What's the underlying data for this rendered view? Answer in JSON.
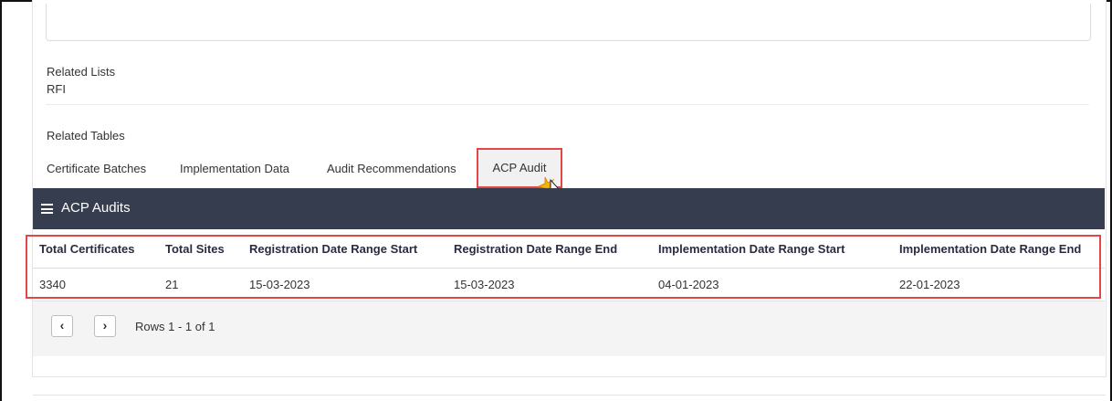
{
  "related_lists": {
    "heading": "Related Lists",
    "items": [
      "RFI"
    ]
  },
  "related_tables": {
    "heading": "Related Tables",
    "tabs": [
      "Certificate Batches",
      "Implementation Data",
      "Audit Recommendations",
      "ACP Audit"
    ],
    "active_tab": "ACP Audit"
  },
  "panel": {
    "title": "ACP Audits",
    "icon": "hamburger-menu-icon"
  },
  "table": {
    "columns": [
      "Total Certificates",
      "Total Sites",
      "Registration Date Range Start",
      "Registration Date Range End",
      "Implementation Date Range Start",
      "Implementation Date Range End"
    ],
    "rows": [
      [
        "3340",
        "21",
        "15-03-2023",
        "15-03-2023",
        "04-01-2023",
        "22-01-2023"
      ]
    ]
  },
  "pagination": {
    "prev_icon": "chevron-left-icon",
    "next_icon": "chevron-right-icon",
    "status": "Rows 1 - 1 of 1"
  },
  "colors": {
    "header_bar": "#363d4f",
    "highlight": "#e04848"
  }
}
